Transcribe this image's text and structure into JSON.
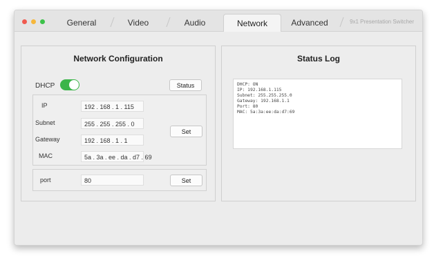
{
  "window": {
    "app_title": "9x1 Presentation Switcher"
  },
  "tabs": [
    "General",
    "Video",
    "Audio",
    "Network",
    "Advanced"
  ],
  "active_tab": "Network",
  "colors": {
    "toggle_on": "#3cb54a",
    "light_close": "#f05a4f",
    "light_min": "#f6b73c",
    "light_max": "#3cc24a"
  },
  "network": {
    "title": "Network Configuration",
    "dhcp_label": "DHCP",
    "dhcp_on": true,
    "status_button": "Status",
    "ip_label": "IP",
    "ip": "192 . 168 .  1  . 115",
    "subnet_label": "Subnet",
    "subnet": "255 . 255 . 255 .  0",
    "gateway_label": "Gateway",
    "gateway": "192 . 168 .  1  .  1",
    "mac_label": "MAC",
    "mac": "5a . 3a . ee . da . d7 . 69",
    "set_button": "Set",
    "port_label": "port",
    "port": "80",
    "port_set_button": "Set"
  },
  "status_log": {
    "title": "Status Log",
    "lines": [
      "DHCP: ON",
      "IP: 192.168.1.115",
      "Subnet: 255.255.255.0",
      "Gateway: 192.168.1.1",
      "Port: 80",
      "MAC: 5a:3a:ee:da:d7:69"
    ]
  }
}
